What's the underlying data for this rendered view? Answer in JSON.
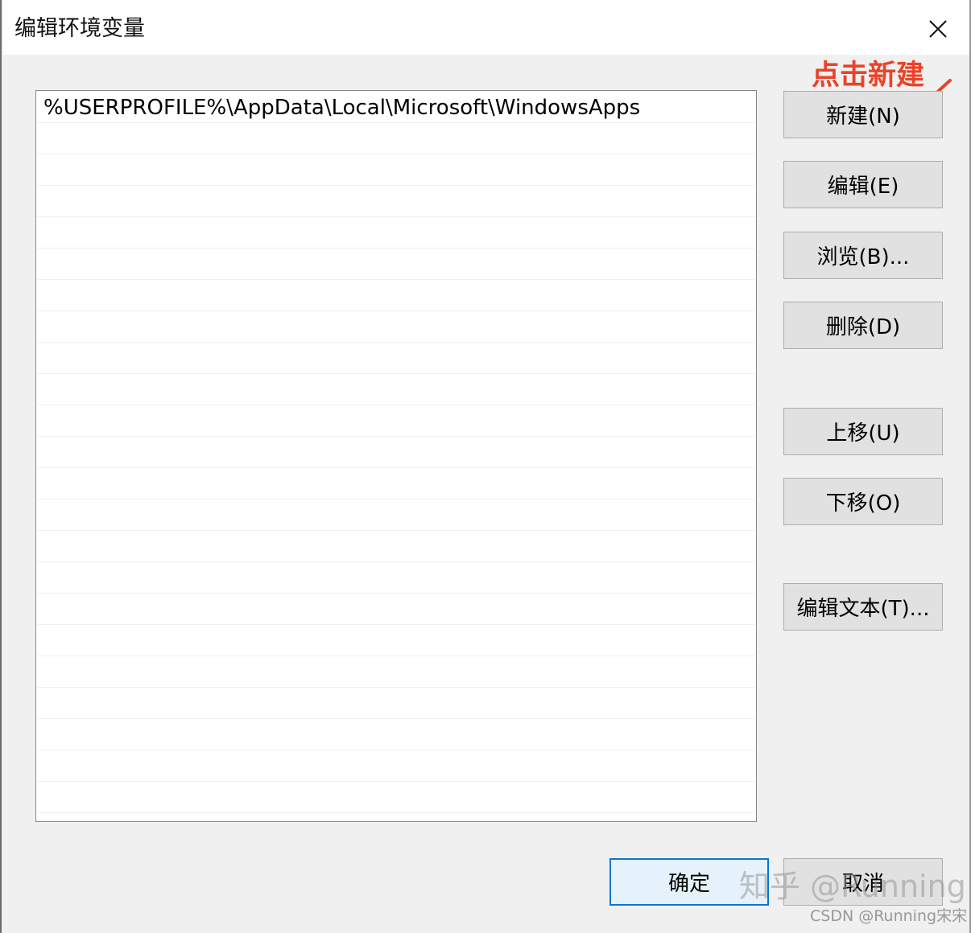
{
  "window": {
    "title": "编辑环境变量"
  },
  "list": {
    "items": [
      "%USERPROFILE%\\AppData\\Local\\Microsoft\\WindowsApps"
    ]
  },
  "buttons": {
    "new": "新建(N)",
    "edit": "编辑(E)",
    "browse": "浏览(B)...",
    "delete": "删除(D)",
    "move_up": "上移(U)",
    "move_down": "下移(O)",
    "edit_text": "编辑文本(T)...",
    "ok": "确定",
    "cancel": "取消"
  },
  "annotation": {
    "text": "点击新建",
    "color": "#e8442a"
  },
  "watermarks": {
    "zhihu": "知乎 @Running",
    "csdn": "CSDN @Running宋宋"
  },
  "colors": {
    "accent": "#0078d7",
    "button_face": "#e1e1e1",
    "dialog_bg": "#f0f0f0"
  }
}
